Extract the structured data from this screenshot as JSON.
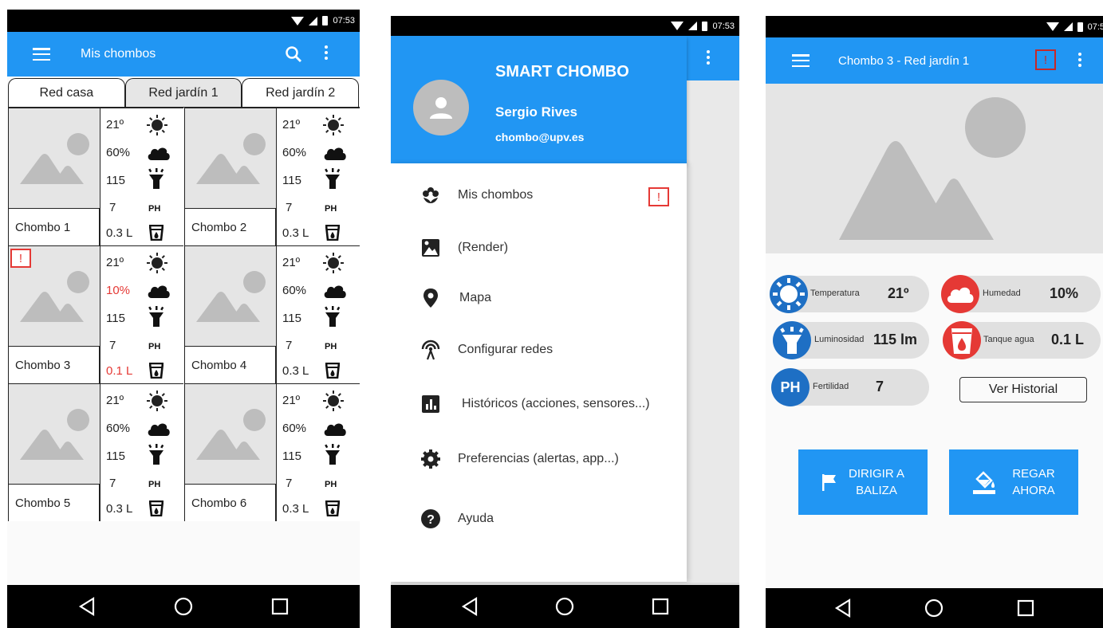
{
  "status_time": "07:53",
  "status_time_clipped": "07:5",
  "screen1": {
    "title": "Mis chombos",
    "tabs": [
      "Red casa",
      "Red jardín 1",
      "Red jardín 2"
    ],
    "ph_label": "PH",
    "alert_mark": "!",
    "cells": [
      {
        "name": "Chombo 1",
        "temp": "21º",
        "hum": "60%",
        "lum": "115",
        "ph": "7",
        "water": "0.3 L"
      },
      {
        "name": "Chombo 2",
        "temp": "21º",
        "hum": "60%",
        "lum": "115",
        "ph": "7",
        "water": "0.3 L"
      },
      {
        "name": "Chombo 3",
        "temp": "21º",
        "hum": "10%",
        "lum": "115",
        "ph": "7",
        "water": "0.1 L"
      },
      {
        "name": "Chombo 4",
        "temp": "21º",
        "hum": "60%",
        "lum": "115",
        "ph": "7",
        "water": "0.3 L"
      },
      {
        "name": "Chombo 5",
        "temp": "21º",
        "hum": "60%",
        "lum": "115",
        "ph": "7",
        "water": "0.3 L"
      },
      {
        "name": "Chombo 6",
        "temp": "21º",
        "hum": "60%",
        "lum": "115",
        "ph": "7",
        "water": "0.3 L"
      }
    ]
  },
  "screen2": {
    "app_name": "SMART CHOMBO",
    "user_name": "Sergio Rives",
    "user_email": "chombo@upv.es",
    "alert_mark": "!",
    "menu": [
      {
        "label": "Mis chombos",
        "icon": "flower-icon"
      },
      {
        "label": "(Render)",
        "icon": "image-icon"
      },
      {
        "label": "Mapa",
        "icon": "map-pin-icon"
      },
      {
        "label": "Configurar redes",
        "icon": "antenna-icon"
      },
      {
        "label": "Históricos (acciones, sensores...)",
        "icon": "bar-chart-icon"
      },
      {
        "label": "Preferencias (alertas, app...)",
        "icon": "gear-icon"
      },
      {
        "label": "Ayuda",
        "icon": "help-icon"
      }
    ]
  },
  "screen3": {
    "title": "Chombo 3 - Red jardín 1",
    "alert_mark": "!",
    "sensors": {
      "temp_label": "Temperatura",
      "temp_value": "21º",
      "hum_label": "Humedad",
      "hum_value": "10%",
      "lum_label": "Luminosidad",
      "lum_value": "115 lm",
      "water_label": "Tanque agua",
      "water_value": "0.1 L",
      "fert_label": "Fertilidad",
      "fert_value": "7",
      "ph_badge": "PH"
    },
    "history_button": "Ver Historial",
    "btn_beacon_line1": "DIRIGIR A",
    "btn_beacon_line2": "BALIZA",
    "btn_water_line1": "REGAR",
    "btn_water_line2": "AHORA"
  },
  "colors": {
    "primary": "#2196f3",
    "alert": "#e53935",
    "temp_circle": "#1e6fc4",
    "hum_circle": "#e53935",
    "placeholder": "#e5e5e5"
  }
}
